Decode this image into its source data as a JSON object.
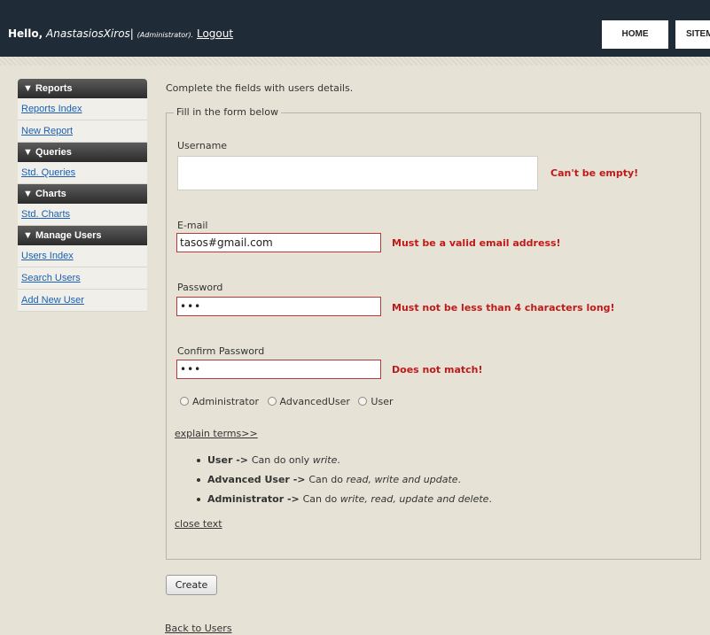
{
  "header": {
    "hello": "Hello,",
    "username": "AnastasiosXiros",
    "separator": "|",
    "role": "(Administrator).",
    "logout": "Logout",
    "tabs": [
      "HOME",
      "SITEM"
    ]
  },
  "sidebar": {
    "sections": [
      {
        "title": "▼ Reports",
        "links": [
          "Reports Index",
          "New Report"
        ]
      },
      {
        "title": "▼ Queries",
        "links": [
          "Std. Queries"
        ]
      },
      {
        "title": "▼ Charts",
        "links": [
          "Std. Charts"
        ]
      },
      {
        "title": "▼ Manage Users",
        "links": [
          "Users Index",
          "Search Users",
          "Add New User"
        ]
      }
    ]
  },
  "form": {
    "intro": "Complete the fields with users details.",
    "legend": "Fill in the form below",
    "username": {
      "label": "Username",
      "value": "",
      "error": "Can't be empty!"
    },
    "email": {
      "label": "E-mail",
      "value": "tasos#gmail.com",
      "error": "Must be a valid email address!"
    },
    "password": {
      "label": "Password",
      "value": "•••",
      "error": "Must not be less than 4 characters long!"
    },
    "confirm": {
      "label": "Confirm Password",
      "value": "•••",
      "error": "Does not match!"
    },
    "roles": [
      "Administrator",
      "AdvancedUser",
      "User"
    ],
    "explain_link": "explain terms>>",
    "terms": [
      {
        "role": "User",
        "arrow": " -> ",
        "text": "Can do only ",
        "perms": "write",
        "end": "."
      },
      {
        "role": "Advanced User",
        "arrow": " -> ",
        "text": "Can do ",
        "perms": "read, write and update",
        "end": "."
      },
      {
        "role": "Administrator",
        "arrow": " -> ",
        "text": "Can do ",
        "perms": "write, read, update and delete",
        "end": "."
      }
    ],
    "close_link": "close text",
    "create_button": "Create",
    "back_link": "Back to Users"
  }
}
